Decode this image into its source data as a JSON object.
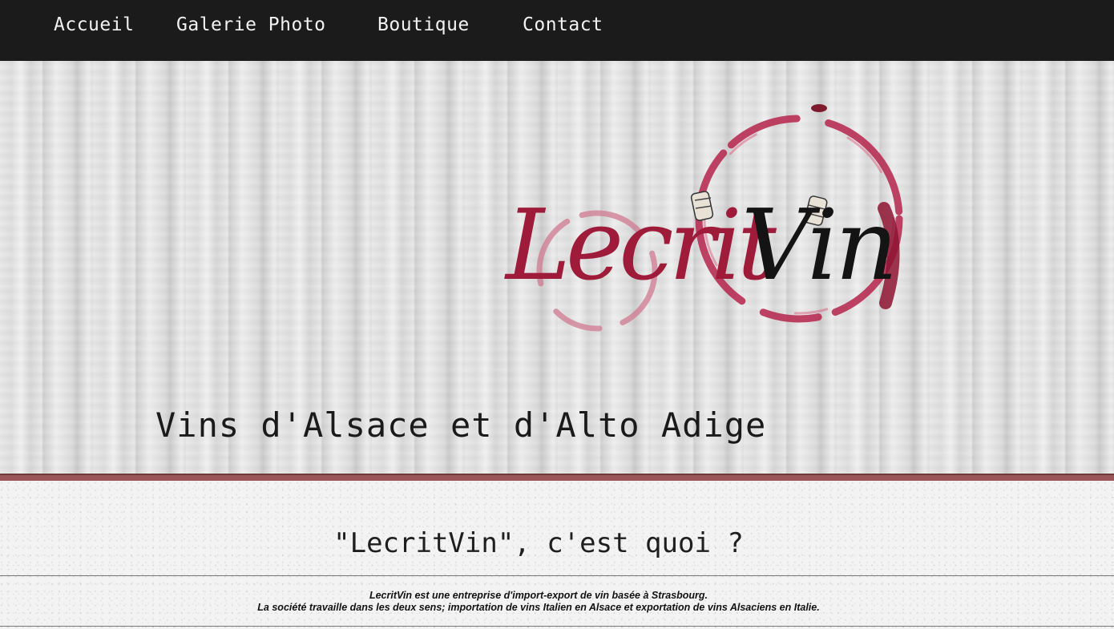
{
  "nav": {
    "items": [
      {
        "label": "Accueil"
      },
      {
        "label": "Galerie Photo"
      },
      {
        "label": "Boutique"
      },
      {
        "label": "Contact"
      }
    ]
  },
  "hero": {
    "logo": {
      "text_part1": "Lecrit",
      "text_part2": "Vin",
      "accent_color": "#9e1b3a",
      "text_color": "#141414"
    },
    "tagline": "Vins d'Alsace et d'Alto Adige"
  },
  "about": {
    "title": "\"LecritVin\", c'est quoi ?",
    "line1": "LecritVin est une entreprise d'import-export de vin basée à Strasbourg.",
    "line2": "La société travaille dans les deux sens; importation de vins Italien en Alsace et exportation de vins Alsaciens en Italie."
  },
  "colors": {
    "navbar_bg": "#1b1b1b",
    "nav_text": "#f2f2f2",
    "divider": "#9a5658",
    "wine": "#9e1b3a"
  }
}
